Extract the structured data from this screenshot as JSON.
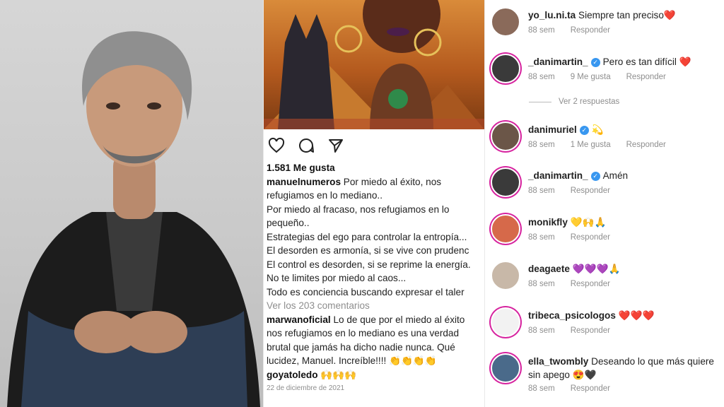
{
  "post": {
    "likes": "1.581 Me gusta",
    "caption_user": "manuelnumeros",
    "caption_lines": [
      "Por miedo al éxito, nos",
      "refugiamos en lo mediano..",
      "Por miedo al fracaso, nos refugiamos en lo",
      "pequeño..",
      "Estrategias del ego para controlar la entropía...",
      "El desorden es armonía, si se vive con prudenc",
      "El control es desorden, si se reprime la energía.",
      "No te limites por miedo al caos...",
      "Todo es conciencia buscando expresar el  taler"
    ],
    "view_comments": "Ver los 203 comentarios",
    "comment1_user": "marwanoficial",
    "comment1_lines": [
      "Lo de que por el miedo al éxito",
      "nos refugiamos en lo mediano es una verdad",
      "brutal que jamás ha dicho nadie nunca. Qué",
      "lucidez, Manuel. Increíble!!!! 👏👏👏👏"
    ],
    "comment2_user": "goyatoledo",
    "comment2_text": "🙌🙌🙌",
    "date": "22 de diciembre de 2021",
    "icons": [
      "heart-icon",
      "comment-icon",
      "share-icon"
    ]
  },
  "comments": [
    {
      "user": "yo_lu.ni.ta",
      "text": "Siempre tan preciso❤️",
      "time": "88 sem",
      "likes": "",
      "reply": "Responder",
      "verified": false
    },
    {
      "user": "_danimartin_",
      "text": "Pero es tan difícil ❤️",
      "time": "88 sem",
      "likes": "9 Me gusta",
      "reply": "Responder",
      "verified": true
    },
    {
      "user": "danimuriel",
      "text": "💫",
      "time": "88 sem",
      "likes": "1 Me gusta",
      "reply": "Responder",
      "verified": true
    },
    {
      "user": "_danimartin_",
      "text": "Amén",
      "time": "88 sem",
      "likes": "",
      "reply": "Responder",
      "verified": true
    },
    {
      "user": "monikfly",
      "text": "💛🙌🙏",
      "time": "88 sem",
      "likes": "",
      "reply": "Responder",
      "verified": false
    },
    {
      "user": "deagaete",
      "text": "💜💜💜🙏",
      "time": "88 sem",
      "likes": "",
      "reply": "Responder",
      "verified": false
    },
    {
      "user": "tribeca_psicologos",
      "text": "❤️❤️❤️",
      "time": "88 sem",
      "likes": "",
      "reply": "Responder",
      "verified": false
    },
    {
      "user": "ella_twombly",
      "text": "Deseando lo que más quiere sin apego 😍🖤",
      "time": "88 sem",
      "likes": "",
      "reply": "Responder",
      "verified": false
    }
  ],
  "replies_link": "Ver 2 respuestas",
  "colors": {
    "verified": "#3897f0",
    "story_ring": "#d6249f"
  }
}
